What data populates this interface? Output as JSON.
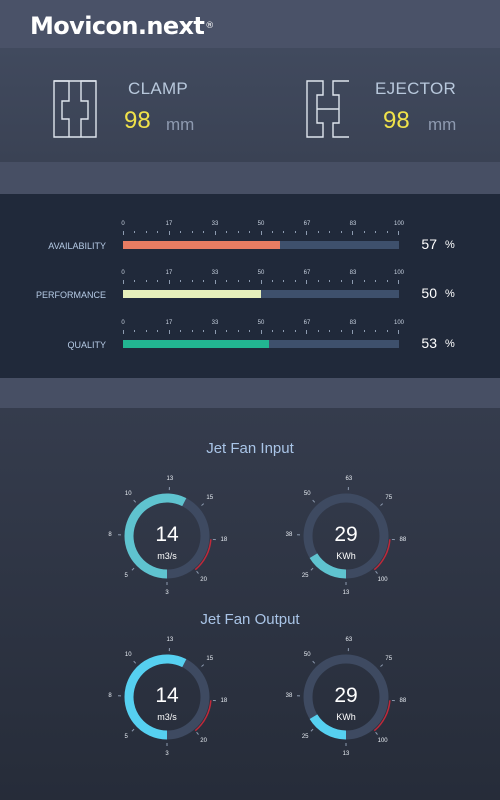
{
  "header": {
    "logo_text": "Movicon.next",
    "logo_mark": "®"
  },
  "machines": [
    {
      "title": "CLAMP",
      "value": "98",
      "unit": "mm",
      "icon": "clamp-icon"
    },
    {
      "title": "EJECTOR",
      "value": "98",
      "unit": "mm",
      "icon": "ejector-icon"
    }
  ],
  "oee": {
    "scale_ticks": [
      "0",
      "17",
      "33",
      "50",
      "67",
      "83",
      "100"
    ],
    "bars": [
      {
        "label": "AVAILABILITY",
        "value": 57,
        "value_text": "57",
        "unit": "%",
        "color": "#e87c62"
      },
      {
        "label": "PERFORMANCE",
        "value": 50,
        "value_text": "50",
        "unit": "%",
        "color": "#e6efbb"
      },
      {
        "label": "QUALITY",
        "value": 53,
        "value_text": "53",
        "unit": "%",
        "color": "#22b591"
      }
    ]
  },
  "jet_fan_input": {
    "title": "Jet Fan Input",
    "gauges": [
      {
        "value": 14,
        "value_text": "14",
        "unit": "m3/s",
        "min": 3,
        "max": 20,
        "labels": [
          "3",
          "5",
          "8",
          "10",
          "13",
          "15",
          "18",
          "20"
        ],
        "color": "#5fc3cf"
      },
      {
        "value": 29,
        "value_text": "29",
        "unit": "KWh",
        "min": 13,
        "max": 100,
        "labels": [
          "13",
          "25",
          "38",
          "50",
          "63",
          "75",
          "88",
          "100"
        ],
        "color": "#5fc3cf"
      }
    ]
  },
  "jet_fan_output": {
    "title": "Jet Fan Output",
    "gauges": [
      {
        "value": 14,
        "value_text": "14",
        "unit": "m3/s",
        "min": 3,
        "max": 20,
        "labels": [
          "3",
          "5",
          "8",
          "10",
          "13",
          "15",
          "18",
          "20"
        ],
        "color": "#56d0f0"
      },
      {
        "value": 29,
        "value_text": "29",
        "unit": "KWh",
        "min": 13,
        "max": 100,
        "labels": [
          "13",
          "25",
          "38",
          "50",
          "63",
          "75",
          "88",
          "100"
        ],
        "color": "#56d0f0"
      }
    ]
  },
  "colors": {
    "track": "#3e4a61",
    "alarm": "#c0293a",
    "accent": "#f0e24a"
  }
}
